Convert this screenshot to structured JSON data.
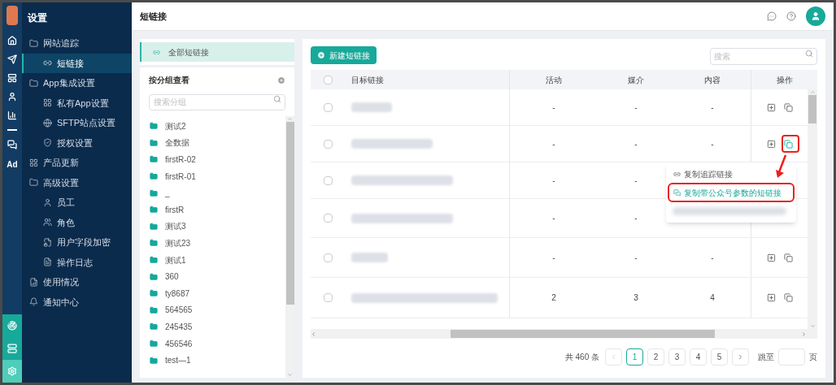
{
  "rail": {
    "ad_label": "Ad",
    "bottom": [
      {
        "selected": false
      },
      {
        "selected": false
      },
      {
        "selected": true
      }
    ]
  },
  "nav": {
    "title": "设置",
    "items": [
      {
        "label": "网站追踪",
        "selected": false,
        "children": [
          {
            "label": "短链接",
            "selected": true
          }
        ]
      },
      {
        "label": "App集成设置",
        "selected": false,
        "children": [
          {
            "label": "私有App设置",
            "selected": false
          },
          {
            "label": "SFTP站点设置",
            "selected": false
          },
          {
            "label": "授权设置",
            "selected": false
          }
        ]
      },
      {
        "label": "产品更新",
        "selected": false
      },
      {
        "label": "高级设置",
        "selected": false,
        "children": [
          {
            "label": "员工",
            "selected": false
          },
          {
            "label": "角色",
            "selected": false
          },
          {
            "label": "用户字段加密",
            "selected": false
          },
          {
            "label": "操作日志",
            "selected": false
          }
        ]
      },
      {
        "label": "使用情况",
        "selected": false
      },
      {
        "label": "通知中心",
        "selected": false
      }
    ]
  },
  "header": {
    "title": "短链接"
  },
  "groups": {
    "all_label": "全部短链接",
    "all_selected": true,
    "title": "按分组查看",
    "search_placeholder": "搜索分组",
    "items": [
      "测试2",
      "全数据",
      "firstR-02",
      "firstR-01",
      "_",
      "firstR",
      "测试3",
      "测试23",
      "测试1",
      "360",
      "ty8687",
      "564565",
      "245435",
      "456546",
      "test—1"
    ]
  },
  "toolbar": {
    "new_button": "新建短链接",
    "search_placeholder": "搜索"
  },
  "table": {
    "select_all_checked": false,
    "columns": [
      "目标链接",
      "活动",
      "媒介",
      "内容",
      "操作"
    ],
    "rows": [
      {
        "checked": false,
        "menu_open": false,
        "activity": "-",
        "medium": "-",
        "content": "-"
      },
      {
        "checked": false,
        "menu_open": true,
        "activity": "-",
        "medium": "-",
        "content": "-"
      },
      {
        "checked": false,
        "activity": "-",
        "medium": "-"
      },
      {
        "checked": false,
        "activity": "-",
        "medium": "-"
      },
      {
        "checked": false,
        "menu_open": false,
        "activity": "-",
        "medium": "-",
        "content": "-"
      },
      {
        "checked": false,
        "menu_open": false,
        "activity": "2",
        "medium": "3",
        "content": "4"
      }
    ]
  },
  "copy_menu": {
    "items": [
      {
        "label": "复制追踪链接",
        "selected": false
      },
      {
        "label": "复制带公众号参数的短链接",
        "selected": true
      }
    ]
  },
  "pagination": {
    "total": "共 460 条",
    "pages": [
      {
        "label": "1",
        "selected": true
      },
      {
        "label": "2",
        "selected": false
      },
      {
        "label": "3",
        "selected": false
      },
      {
        "label": "4",
        "selected": false
      },
      {
        "label": "5",
        "selected": false
      }
    ],
    "jump_label": "跳至",
    "page_suffix": "页"
  }
}
